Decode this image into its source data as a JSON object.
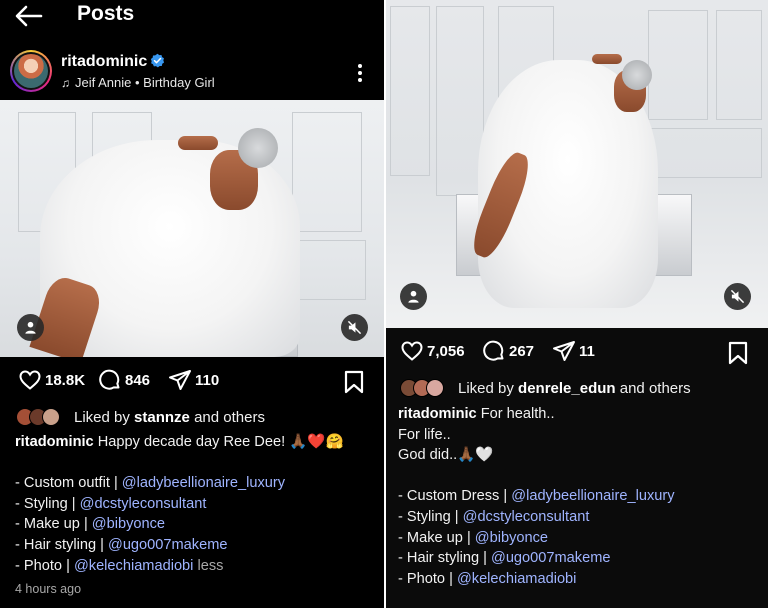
{
  "left_post": {
    "header": {
      "title": "Posts",
      "back_icon": "back-arrow-icon"
    },
    "profile": {
      "username": "ritadominic",
      "audio": "Jeif Annie • Birthday Girl"
    },
    "actions": {
      "likes": "18.8K",
      "comments": "846",
      "shares": "110"
    },
    "liked_by": {
      "prefix": "Liked by ",
      "user": "stannze",
      "suffix": " and others"
    },
    "caption": {
      "username": "ritadominic",
      "text": " Happy decade day Ree Dee! 🙏🏾❤️🤗",
      "credits": [
        {
          "label": "- Custom outfit | ",
          "mention": "@ladybeellionaire_luxury"
        },
        {
          "label": "- Styling | ",
          "mention": "@dcstyleconsultant"
        },
        {
          "label": "- Make up | ",
          "mention": "@bibyonce"
        },
        {
          "label": "- Hair styling | ",
          "mention": "@ugo007makeme"
        },
        {
          "label": "- Photo | ",
          "mention": "@kelechiamadiobi",
          "more": " less"
        }
      ]
    },
    "timestamp": "4 hours ago"
  },
  "right_post": {
    "actions": {
      "likes": "7,056",
      "comments": "267",
      "shares": "11"
    },
    "liked_by": {
      "prefix": "Liked by ",
      "user": "denrele_edun",
      "suffix": " and others"
    },
    "caption": {
      "username": "ritadominic",
      "text": " For health..",
      "lines": [
        "For life..",
        "God did..🙏🏾🤍"
      ],
      "credits": [
        {
          "label": "- Custom Dress | ",
          "mention": "@ladybeellionaire_luxury"
        },
        {
          "label": "- Styling | ",
          "mention": "@dcstyleconsultant"
        },
        {
          "label": "- Make up | ",
          "mention": "@bibyonce"
        },
        {
          "label": "- Hair styling | ",
          "mention": "@ugo007makeme"
        },
        {
          "label": "- Photo | ",
          "mention": "@kelechiamadiobi"
        }
      ]
    }
  },
  "colors": {
    "background": "#000000",
    "mention": "#9fb4ff",
    "verified": "#3897f0",
    "muted": "#a8a8a8"
  }
}
